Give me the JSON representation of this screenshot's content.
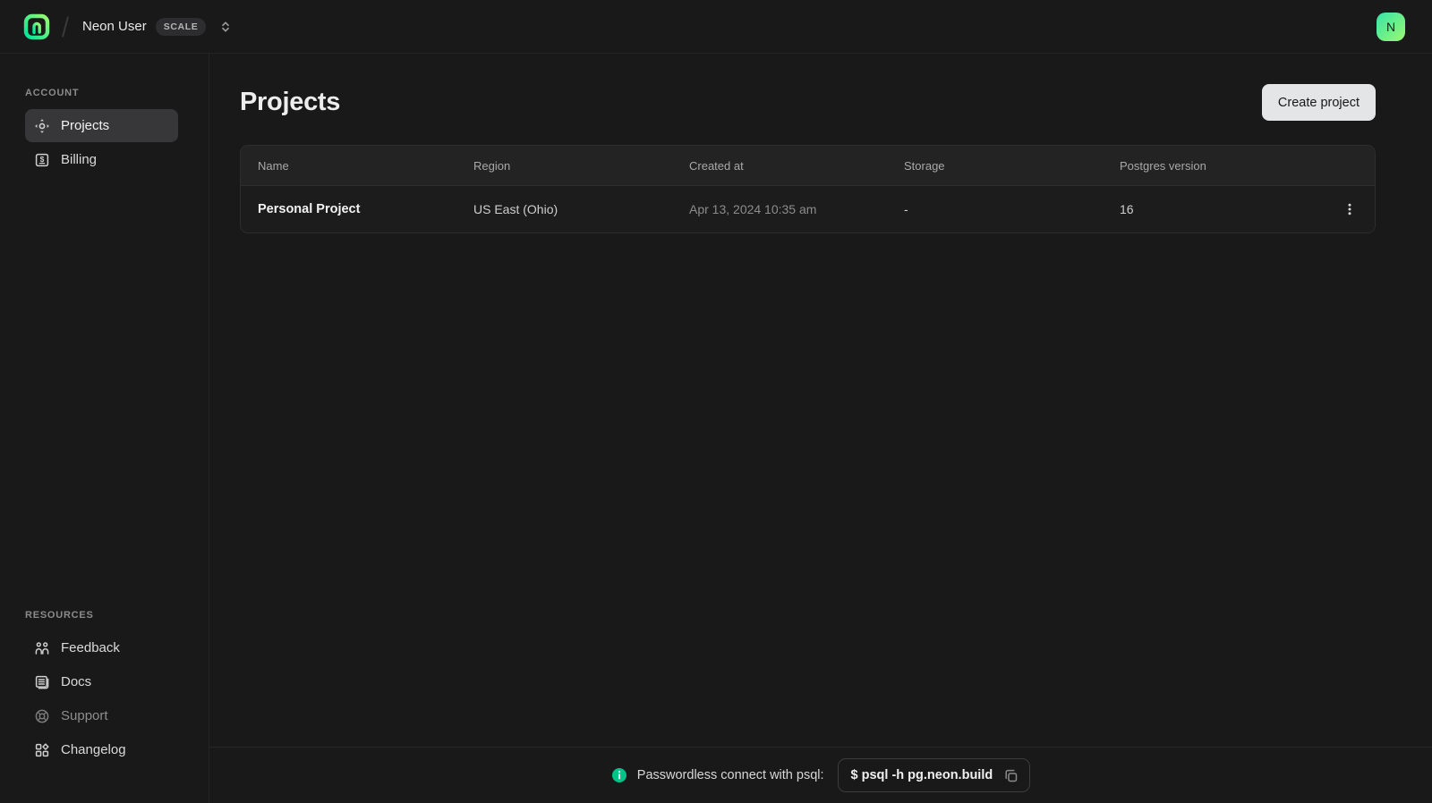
{
  "header": {
    "org_name": "Neon User",
    "plan_badge": "SCALE",
    "avatar_letter": "N"
  },
  "sidebar": {
    "sections": [
      {
        "label": "ACCOUNT",
        "items": [
          {
            "label": "Projects",
            "icon": "projects-move-icon",
            "active": true
          },
          {
            "label": "Billing",
            "icon": "billing-dollar-icon",
            "active": false
          }
        ]
      },
      {
        "label": "RESOURCES",
        "items": [
          {
            "label": "Feedback",
            "icon": "people-icon"
          },
          {
            "label": "Docs",
            "icon": "document-icon"
          },
          {
            "label": "Support",
            "icon": "lifebuoy-icon"
          },
          {
            "label": "Changelog",
            "icon": "squares-grid-icon"
          }
        ]
      }
    ]
  },
  "main": {
    "title": "Projects",
    "create_button_label": "Create project",
    "table": {
      "columns": [
        "Name",
        "Region",
        "Created at",
        "Storage",
        "Postgres version"
      ],
      "rows": [
        {
          "name": "Personal Project",
          "region": "US East (Ohio)",
          "created_at": "Apr 13, 2024 10:35 am",
          "storage": "-",
          "postgres_version": "16"
        }
      ]
    }
  },
  "footer": {
    "label": "Passwordless connect with psql:",
    "command": "$ psql -h pg.neon.build"
  },
  "icons": {
    "logo": "neon-logo-icon",
    "org_selector": "up-down-chevron-icon",
    "row_actions": "kebab-menu-icon",
    "footer_info": "info-icon",
    "command_copy": "copy-icon"
  },
  "colors": {
    "background": "#191919",
    "border": "#272727",
    "table_header_bg": "#232323",
    "table_row_bg": "#1c1c1c",
    "active_item_bg": "#37373a",
    "create_button_bg": "#e4e5e7",
    "brand_green": "#00e599",
    "brand_lime": "#9cf873",
    "info_green": "#00c389"
  }
}
